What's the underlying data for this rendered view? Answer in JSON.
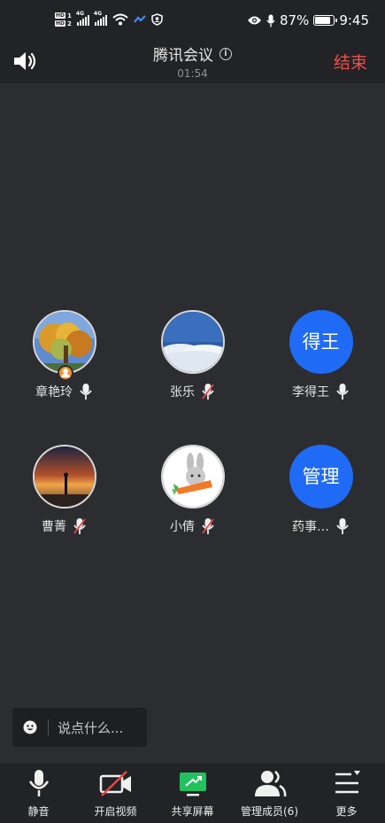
{
  "status_bar": {
    "battery": "87%",
    "battery_level": 0.87,
    "time": "9:45",
    "network_type": "4G",
    "hd_labels": [
      "HD",
      "HD"
    ]
  },
  "header": {
    "title": "腾讯会议",
    "timer": "01:54",
    "end_label": "结束",
    "icons": [
      "speaker-icon",
      "info-icon"
    ]
  },
  "participants": [
    {
      "name": "章艳玲",
      "avatar": "photo-autumn-tree",
      "is_host": true,
      "mic": "on"
    },
    {
      "name": "张乐",
      "avatar": "photo-clouds",
      "is_host": false,
      "mic": "muted"
    },
    {
      "name": "李得王",
      "avatar_text": "得王",
      "is_host": false,
      "mic": "on"
    },
    {
      "name": "曹菁",
      "avatar": "photo-sunset-silhouette",
      "is_host": false,
      "mic": "muted"
    },
    {
      "name": "小倩",
      "avatar": "cartoon-rabbit-carrot",
      "is_host": false,
      "mic": "muted"
    },
    {
      "name": "药事…",
      "avatar_text": "管理",
      "is_host": false,
      "mic": "on"
    }
  ],
  "chat": {
    "placeholder": "说点什么..."
  },
  "toolbar": [
    {
      "label": "静音",
      "icon": "microphone-icon"
    },
    {
      "label": "开启视频",
      "icon": "video-off-icon"
    },
    {
      "label": "共享屏幕",
      "icon": "share-screen-icon"
    },
    {
      "label": "管理成员(6)",
      "icon": "members-icon"
    },
    {
      "label": "更多",
      "icon": "more-menu-icon"
    }
  ],
  "colors": {
    "background": "#2b2d31",
    "bar": "#222326",
    "end": "#f24c4c",
    "avatar_blue": "#1f6bf5",
    "share_green": "#21c25e",
    "muted_red": "#e54848"
  }
}
